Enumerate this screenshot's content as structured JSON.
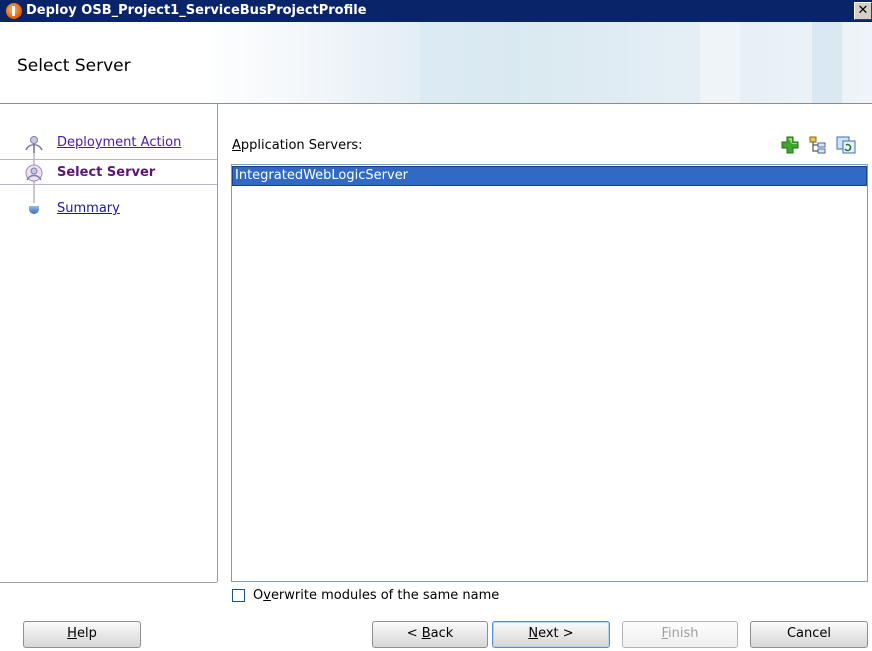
{
  "window": {
    "title": "Deploy OSB_Project1_ServiceBusProjectProfile",
    "close_glyph": "✕"
  },
  "header": {
    "page_title": "Select Server"
  },
  "nav": {
    "items": [
      {
        "label": "Deployment Action",
        "state": "visited",
        "icon": "step-person-icon"
      },
      {
        "label": "Select Server",
        "state": "current",
        "icon": "step-person-current-icon"
      },
      {
        "label": "Summary",
        "state": "pending",
        "icon": "step-dot-icon"
      }
    ]
  },
  "content": {
    "list_label_mnemonic": "A",
    "list_label_rest": "pplication Servers:",
    "toolbar_icons": [
      "add-icon",
      "tree-icon",
      "refresh-icon"
    ],
    "servers": [
      "IntegratedWebLogicServer"
    ],
    "selected_server": "IntegratedWebLogicServer",
    "overwrite_checkbox": {
      "label_pre": "O",
      "label_mnemonic": "v",
      "label_rest": "erwrite modules of the same name",
      "checked": false
    }
  },
  "buttons": {
    "help": {
      "mnemonic": "H",
      "rest": "elp"
    },
    "back": {
      "pre": "< ",
      "mnemonic": "B",
      "rest": "ack"
    },
    "next": {
      "mnemonic": "N",
      "rest": "ext >"
    },
    "finish": {
      "mnemonic": "F",
      "rest": "inish",
      "enabled": false
    },
    "cancel": {
      "label": "Cancel"
    }
  },
  "colors": {
    "titlebar": "#0a246a",
    "selection": "#316ac5",
    "nav_current": "#5a1677",
    "nav_link": "#4b1aa0"
  }
}
